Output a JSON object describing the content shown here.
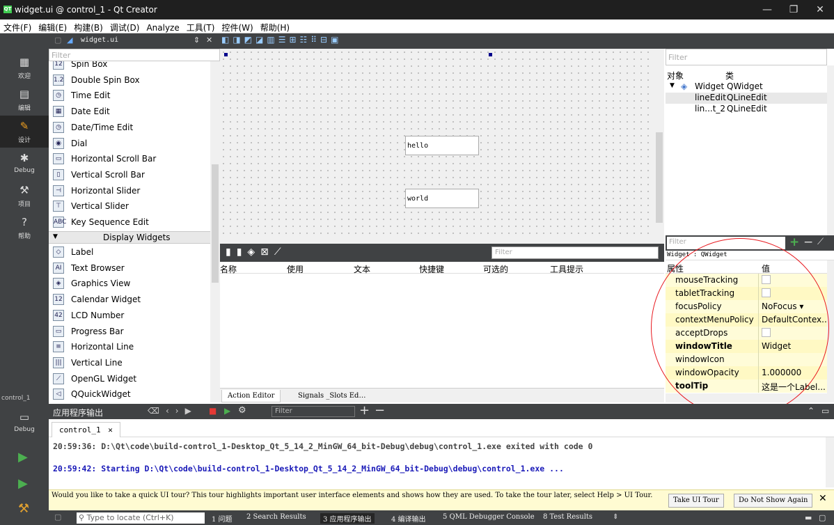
{
  "window": {
    "title": "widget.ui @ control_1 - Qt Creator",
    "icon": "qt-icon",
    "min": "—",
    "restore": "❐",
    "close": "✕"
  },
  "menu": [
    "文件(F)",
    "编辑(E)",
    "构建(B)",
    "调试(D)",
    "Analyze",
    "工具(T)",
    "控件(W)",
    "帮助(H)"
  ],
  "modes": [
    {
      "label": "欢迎",
      "icon": "welcome-grid-icon"
    },
    {
      "label": "编辑",
      "icon": "edit-icon"
    },
    {
      "label": "设计",
      "icon": "design-pen-icon"
    },
    {
      "label": "Debug",
      "icon": "debug-bug-icon"
    },
    {
      "label": "项目",
      "icon": "project-wrench-icon"
    },
    {
      "label": "帮助",
      "icon": "help-icon"
    }
  ],
  "kit": {
    "project": "control_1",
    "mode": "Debug"
  },
  "toolbar": {
    "file": "widget.ui"
  },
  "left_filter": {
    "placeholder": "Filter"
  },
  "widgets_top": [
    {
      "label": "Spin Box",
      "icon": "12"
    },
    {
      "label": "Double Spin Box",
      "icon": "1.2"
    },
    {
      "label": "Time Edit",
      "icon": "◷"
    },
    {
      "label": "Date Edit",
      "icon": "▦"
    },
    {
      "label": "Date/Time Edit",
      "icon": "◷"
    },
    {
      "label": "Dial",
      "icon": "◉"
    },
    {
      "label": "Horizontal Scroll Bar",
      "icon": "▭"
    },
    {
      "label": "Vertical Scroll Bar",
      "icon": "▯"
    },
    {
      "label": "Horizontal Slider",
      "icon": "⊣"
    },
    {
      "label": "Vertical Slider",
      "icon": "⊤"
    },
    {
      "label": "Key Sequence Edit",
      "icon": "ABC"
    }
  ],
  "category": "Display Widgets",
  "widgets_display": [
    {
      "label": "Label",
      "icon": "◇"
    },
    {
      "label": "Text Browser",
      "icon": "AI"
    },
    {
      "label": "Graphics View",
      "icon": "◈"
    },
    {
      "label": "Calendar Widget",
      "icon": "12"
    },
    {
      "label": "LCD Number",
      "icon": "42"
    },
    {
      "label": "Progress Bar",
      "icon": "▭"
    },
    {
      "label": "Horizontal Line",
      "icon": "≡"
    },
    {
      "label": "Vertical Line",
      "icon": "|||"
    },
    {
      "label": "OpenGL Widget",
      "icon": "⟋"
    },
    {
      "label": "QQuickWidget",
      "icon": "◁"
    }
  ],
  "canvas": {
    "edit1": "hello",
    "edit2": "world"
  },
  "action_editor": {
    "filter": "Filter",
    "columns": [
      "名称",
      "使用",
      "文本",
      "快捷键",
      "可选的",
      "工具提示"
    ],
    "tabs": [
      "Action Editor",
      "Signals _Slots Ed…"
    ]
  },
  "object_inspector": {
    "filter": "Filter",
    "col_object": "对象",
    "col_class": "类",
    "rows": [
      {
        "name": "Widget",
        "cls": "QWidget"
      },
      {
        "name": "lineEdit",
        "cls": "QLineEdit"
      },
      {
        "name": "lin...t_2",
        "cls": "QLineEdit"
      }
    ]
  },
  "property_editor": {
    "filter": "Filter",
    "class_line": "Widget : QWidget",
    "col_prop": "属性",
    "col_value": "值",
    "rows": [
      {
        "name": "mouseTracking",
        "value": "",
        "checkbox": true
      },
      {
        "name": "tabletTracking",
        "value": "",
        "checkbox": true
      },
      {
        "name": "focusPolicy",
        "value": "NoFocus"
      },
      {
        "name": "contextMenuPolicy",
        "value": "DefaultContex..."
      },
      {
        "name": "acceptDrops",
        "value": "",
        "checkbox": true
      },
      {
        "name": "windowTitle",
        "value": "Widget",
        "bold": true
      },
      {
        "name": "windowIcon",
        "value": ""
      },
      {
        "name": "windowOpacity",
        "value": "1.000000"
      },
      {
        "name": "toolTip",
        "value": "这是一个Label...",
        "bold": true
      }
    ]
  },
  "output": {
    "title": "应用程序输出",
    "filter": "Filter",
    "tab": "control_1",
    "lines": [
      {
        "text": "20:59:36: D:\\Qt\\code\\build-control_1-Desktop_Qt_5_14_2_MinGW_64_bit-Debug\\debug\\control_1.exe exited with code 0",
        "color": "#444444"
      },
      {
        "text": "20:59:42: Starting D:\\Qt\\code\\build-control_1-Desktop_Qt_5_14_2_MinGW_64_bit-Debug\\debug\\control_1.exe ...",
        "color": "#1a1ab8"
      }
    ]
  },
  "tour": {
    "text": "Would you like to take a quick UI tour? This tour highlights important user interface elements and shows how they are used. To take the tour later, select Help > UI Tour.",
    "take": "Take UI Tour",
    "dont": "Do Not Show Again"
  },
  "status": {
    "locate": "Type to locate (Ctrl+K)",
    "tabs": [
      "1 问题",
      "2 Search Results",
      "3 应用程序输出",
      "4 编译输出",
      "5 QML Debugger Console",
      "8 Test Results"
    ]
  }
}
